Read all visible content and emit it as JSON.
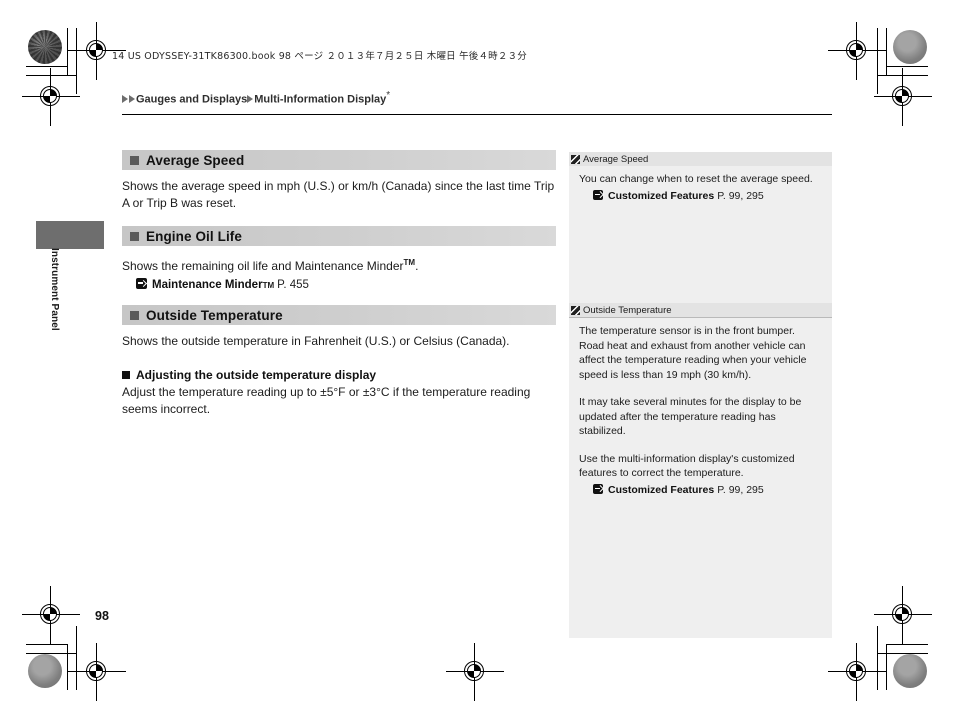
{
  "doc": {
    "header_line": "14 US ODYSSEY-31TK86300.book   98 ページ   ２０１３年７月２５日   木曜日   午後４時２３分",
    "page_number": "98",
    "side_tab_label": "Instrument Panel"
  },
  "breadcrumb": {
    "parent": "Gauges and Displays",
    "child": "Multi-Information Display",
    "asterisk": "*"
  },
  "main": {
    "sections": [
      {
        "heading": "Average Speed",
        "body": "Shows the average speed in mph (U.S.) or km/h (Canada) since the last time Trip A or Trip B was reset."
      },
      {
        "heading": "Engine Oil Life",
        "body": "Shows the remaining oil life and Maintenance Minder",
        "body_tm": "TM",
        "body_tail": ".",
        "ref_title": "Maintenance Minder",
        "ref_tm": "TM",
        "ref_page": "P. 455"
      },
      {
        "heading": "Outside Temperature",
        "body": "Shows the outside temperature in Fahrenheit (U.S.) or Celsius (Canada).",
        "subheading": "Adjusting the outside temperature display",
        "sub_body": "Adjust the temperature reading up to ±5°F or ±3°C if the temperature reading seems incorrect."
      }
    ]
  },
  "sidebar": {
    "sections": [
      {
        "title": "Average Speed",
        "paragraphs": [
          "You can change when to reset the average speed."
        ],
        "ref_title": "Customized Features",
        "ref_page": "P. 99, 295"
      },
      {
        "title": "Outside Temperature",
        "paragraphs": [
          "The temperature sensor is in the front bumper. Road heat and exhaust from another vehicle can affect the temperature reading when your vehicle speed is less than 19 mph (30 km/h).",
          "It may take several minutes for the display to be updated after the temperature reading has stabilized.",
          "Use the multi-information display's customized features to correct the temperature."
        ],
        "ref_title": "Customized Features",
        "ref_page": "P. 99, 295"
      }
    ]
  },
  "colors": {
    "section_heading_bg": "#cfcfcf",
    "sidebar_bg": "#efefef",
    "sidebar_head_bg": "#e3e3e3",
    "side_tab_bg": "#6e6e6e"
  }
}
